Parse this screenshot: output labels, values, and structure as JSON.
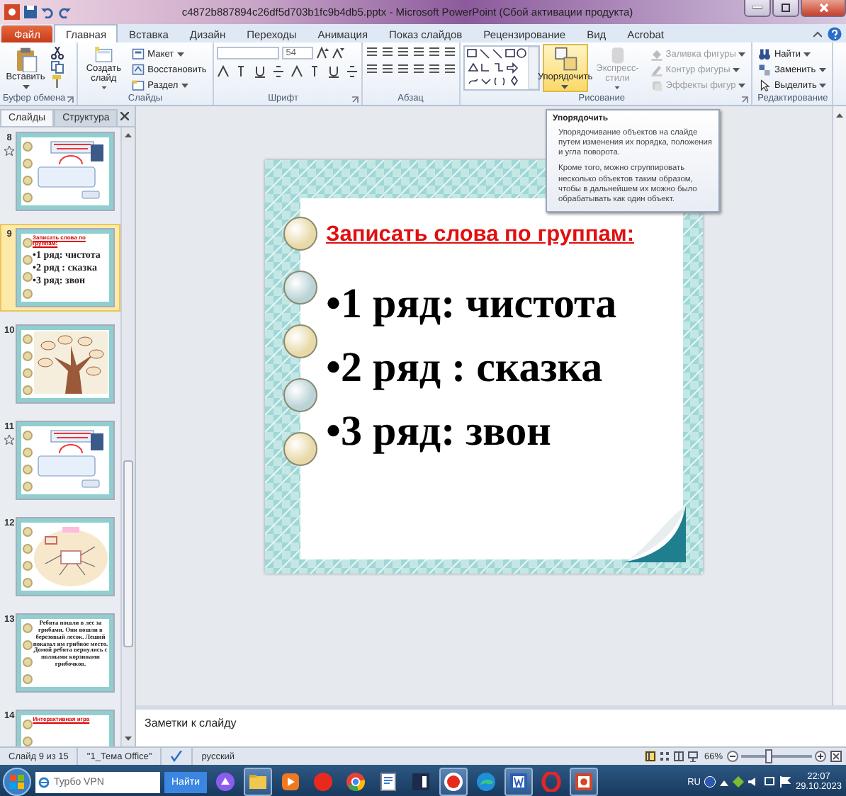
{
  "title_bar": {
    "title": "c4872b887894c26df5d703b1fc9b4db5.pptx - Microsoft PowerPoint (Сбой активации продукта)"
  },
  "ribbon_tabs": [
    {
      "label": "Файл",
      "kind": "file",
      "selected": false
    },
    {
      "label": "Главная",
      "kind": "tab",
      "selected": true
    },
    {
      "label": "Вставка",
      "kind": "tab",
      "selected": false
    },
    {
      "label": "Дизайн",
      "kind": "tab",
      "selected": false
    },
    {
      "label": "Переходы",
      "kind": "tab",
      "selected": false
    },
    {
      "label": "Анимация",
      "kind": "tab",
      "selected": false
    },
    {
      "label": "Показ слайдов",
      "kind": "tab",
      "selected": false
    },
    {
      "label": "Рецензирование",
      "kind": "tab",
      "selected": false
    },
    {
      "label": "Вид",
      "kind": "tab",
      "selected": false
    },
    {
      "label": "Acrobat",
      "kind": "tab",
      "selected": false
    }
  ],
  "ribbon_groups": [
    {
      "label": "Буфер обмена",
      "launcher": true,
      "buttons": [
        {
          "kind": "paste",
          "label": "Вставить",
          "hovered": false,
          "disabled": false
        },
        {
          "kind": "clipicons"
        }
      ]
    },
    {
      "label": "Слайды",
      "launcher": false,
      "buttons": [
        {
          "kind": "newslide",
          "label": "Создать слайд",
          "hovered": false,
          "disabled": false
        },
        {
          "kind": "layout",
          "label": "Макет",
          "hovered": false,
          "disabled": false
        },
        {
          "kind": "reset",
          "label": "Восстановить",
          "hovered": false,
          "disabled": false
        },
        {
          "kind": "section",
          "label": "Раздел",
          "hovered": false,
          "disabled": false
        }
      ]
    },
    {
      "label": "Шрифт",
      "launcher": true,
      "buttons": [
        {
          "kind": "fonttools",
          "font_size": "54"
        }
      ]
    },
    {
      "label": "Абзац",
      "launcher": false,
      "buttons": [
        {
          "kind": "paratools"
        }
      ]
    },
    {
      "label": "Рисование",
      "launcher": true,
      "buttons": [
        {
          "kind": "shapes"
        },
        {
          "kind": "arrange",
          "label": "Упорядочить",
          "hovered": true,
          "disabled": false
        },
        {
          "kind": "quickstyles",
          "label": "Экспресс-стили",
          "hovered": false,
          "disabled": true
        },
        {
          "kind": "fill",
          "label": "Заливка фигуры",
          "hovered": false,
          "disabled": true
        },
        {
          "kind": "outline",
          "label": "Контур фигуры",
          "hovered": false,
          "disabled": true
        },
        {
          "kind": "effects",
          "label": "Эффекты фигур",
          "hovered": false,
          "disabled": true
        }
      ]
    },
    {
      "label": "Редактирование",
      "launcher": false,
      "buttons": [
        {
          "kind": "find",
          "label": "Найти",
          "hovered": false,
          "disabled": false
        },
        {
          "kind": "replace",
          "label": "Заменить",
          "hovered": false,
          "disabled": false
        },
        {
          "kind": "select",
          "label": "Выделить",
          "hovered": false,
          "disabled": false
        }
      ]
    }
  ],
  "panel_tabs": [
    {
      "label": "Слайды",
      "selected": true
    },
    {
      "label": "Структура",
      "selected": false
    }
  ],
  "thumbnails": [
    {
      "number": "8",
      "kind": "cards",
      "animated": true,
      "selected": false
    },
    {
      "number": "9",
      "kind": "text",
      "animated": false,
      "selected": true,
      "title": "Записать слова по группам:",
      "lines": [
        "•1 ряд: чистота",
        "•2 ряд : сказка",
        "•3 ряд: звон"
      ]
    },
    {
      "number": "10",
      "kind": "tree",
      "animated": false,
      "selected": false
    },
    {
      "number": "11",
      "kind": "cards",
      "animated": true,
      "selected": false
    },
    {
      "number": "12",
      "kind": "diagram",
      "animated": false,
      "selected": false
    },
    {
      "number": "13",
      "kind": "paragraph",
      "animated": false,
      "selected": false,
      "lines": [
        "Ребята пошли в лес за грибами. Они вошли в березовый лесок. Леший показал им грибное место. Домой ребята вернулись с полными корзинами грибочков."
      ]
    },
    {
      "number": "14",
      "kind": "text",
      "animated": false,
      "selected": false,
      "title": "Интерактивная игра"
    }
  ],
  "slide": {
    "title": "Записать слова по группам:",
    "bullets": [
      "•1 ряд: чистота",
      "•2 ряд : сказка",
      "•3 ряд: звон"
    ]
  },
  "tooltip": {
    "title": "Упорядочить",
    "paragraphs": [
      "Упорядочивание объектов на слайде путем изменения их порядка, положения и угла поворота.",
      "Кроме того, можно сгруппировать несколько объектов таким образом, чтобы в дальнейшем их можно было обрабатывать как один объект."
    ]
  },
  "notes": {
    "placeholder": "Заметки к слайду"
  },
  "status_bar": {
    "slide": "Слайд 9 из 15",
    "theme": "\"1_Тема Office\"",
    "language": "русский",
    "zoom": "66%",
    "zoom_level": {
      "level": 0.38
    }
  },
  "taskbar": {
    "search": {
      "placeholder": "Турбо VPN"
    },
    "search_button": "Найти",
    "apps": [
      {
        "kind": "assistant",
        "running": false
      },
      {
        "kind": "explorer",
        "running": true
      },
      {
        "kind": "player",
        "running": false
      },
      {
        "kind": "yandex",
        "running": false
      },
      {
        "kind": "chrome",
        "running": false
      },
      {
        "kind": "reader",
        "running": false
      },
      {
        "kind": "ew",
        "running": false
      },
      {
        "kind": "ybrowser",
        "running": true
      },
      {
        "kind": "edge",
        "running": false
      },
      {
        "kind": "word",
        "running": true
      },
      {
        "kind": "opera",
        "running": false
      },
      {
        "kind": "powerpoint",
        "running": true
      }
    ],
    "language": "RU",
    "time": "22:07",
    "date": "29.10.2023"
  }
}
